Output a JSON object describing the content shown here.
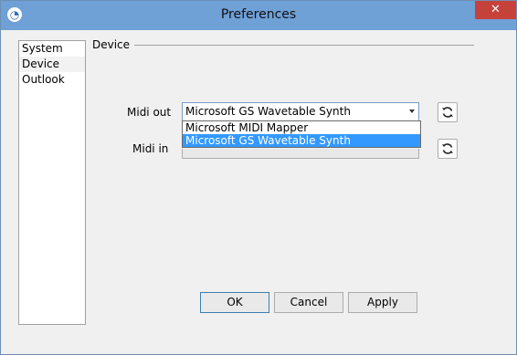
{
  "window": {
    "title": "Preferences",
    "close_glyph": "✕",
    "app_icon": "app-logo-icon"
  },
  "sidebar": {
    "items": [
      {
        "label": "System"
      },
      {
        "label": "Device"
      },
      {
        "label": "Outlook"
      }
    ],
    "selected": "Device"
  },
  "section": {
    "title": "Device"
  },
  "midi_out": {
    "label": "Midi out",
    "value": "Microsoft GS Wavetable Synth",
    "options": [
      "Microsoft MIDI Mapper",
      "Microsoft GS Wavetable Synth"
    ],
    "highlighted": "Microsoft GS Wavetable Synth"
  },
  "midi_in": {
    "label": "Midi in"
  },
  "buttons": {
    "ok": "OK",
    "cancel": "Cancel",
    "apply": "Apply"
  },
  "colors": {
    "titlebar": "#6fa0d6",
    "close": "#c7413b",
    "highlight": "#3399ff"
  }
}
